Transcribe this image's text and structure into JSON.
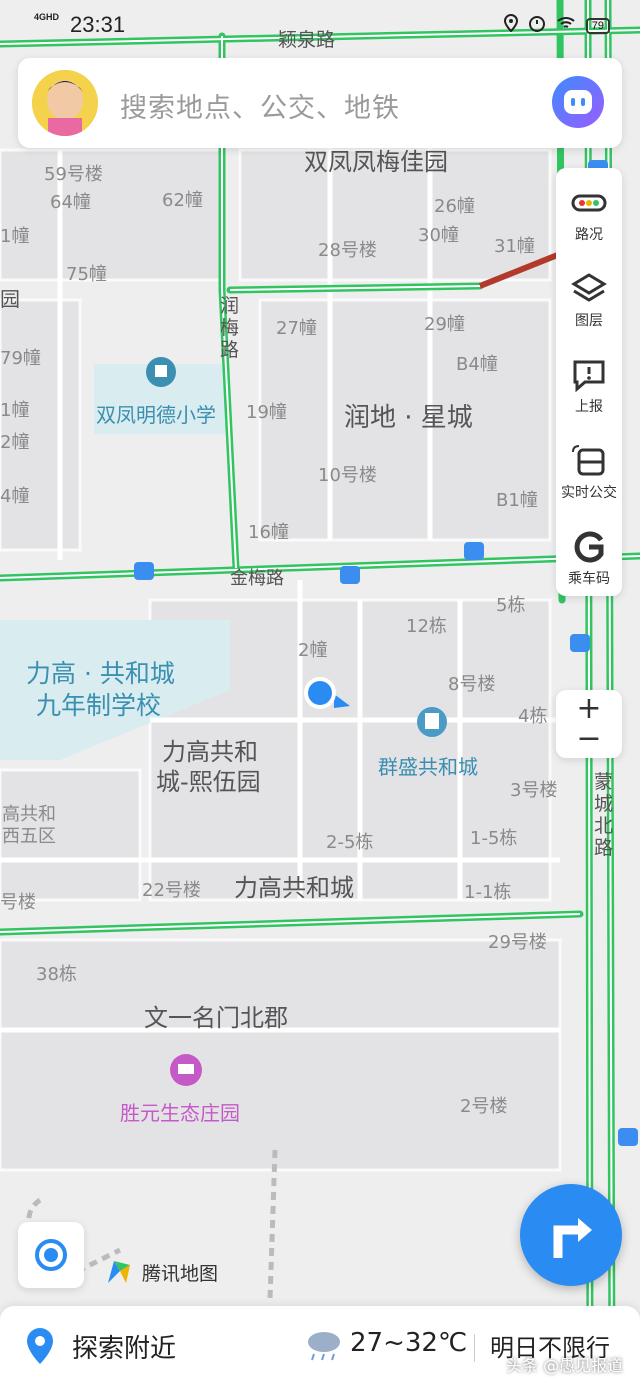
{
  "status_bar": {
    "network": "4GHD",
    "time": "23:31",
    "battery": "79"
  },
  "search": {
    "placeholder": "搜索地点、公交、地铁"
  },
  "toolbar": [
    {
      "label": "路况",
      "icon": "traffic-light-icon"
    },
    {
      "label": "图层",
      "icon": "layers-icon"
    },
    {
      "label": "上报",
      "icon": "report-icon"
    },
    {
      "label": "实时公交",
      "icon": "bus-icon"
    },
    {
      "label": "乘车码",
      "icon": "ride-code-icon"
    }
  ],
  "zoom": {
    "in": "+",
    "out": "−"
  },
  "map_labels": {
    "road_top": "颖泉路",
    "r59": "59号楼",
    "r64": "64幢",
    "r62": "62幢",
    "r1a": "1幢",
    "r75": "75幢",
    "yuan": "园",
    "shuangfeng": "双凤凤梅佳园",
    "b26": "26幢",
    "b28": "28号楼",
    "b30": "30幢",
    "b31": "31幢",
    "runmeilu": "润梅路",
    "b27": "27幢",
    "b29": "29幢",
    "b79": "79幢",
    "b4": "B4幢",
    "school": "双凤明德小学",
    "b19": "19幢",
    "rundi": "润地 · 星城",
    "b1b": "1幢",
    "b2": "2幢",
    "b10": "10号楼",
    "b4a": "4幢",
    "b16": "16幢",
    "bb1": "B1幢",
    "jinmeilu": "金梅路",
    "b5": "5栋",
    "b12": "12栋",
    "b2z": "2幢",
    "school2_l1": "力高 · 共和城",
    "school2_l2": "九年制学校",
    "b8": "8号楼",
    "b4d": "4栋",
    "lgh_l1": "力高共和",
    "lgh_l2": "城-熙伍园",
    "qunsheng": "群盛共和城",
    "b3": "3号楼",
    "xiwu_l1": "高共和",
    "xiwu_l2": "西五区",
    "b25": "2-5栋",
    "b15": "1-5栋",
    "mengcheng": "蒙城北路",
    "b22": "22号楼",
    "lgh": "力高共和城",
    "b11": "1-1栋",
    "lou": "号楼",
    "b29b": "29号楼",
    "b38": "38栋",
    "wenyi": "文一名门北郡",
    "shengyuan": "胜元生态庄园",
    "b2c": "2号楼"
  },
  "brand": "腾讯地图",
  "bottom_bar": {
    "explore": "探索附近",
    "weather": "27~32℃",
    "limit": "明日不限行"
  },
  "watermark": "头条 @愚见报道",
  "colors": {
    "road_green": "#33c462",
    "road_red": "#b33a2a",
    "accent": "#2a8cf2",
    "school_blue": "#3b8fb0",
    "poi_pink": "#c659c8"
  }
}
